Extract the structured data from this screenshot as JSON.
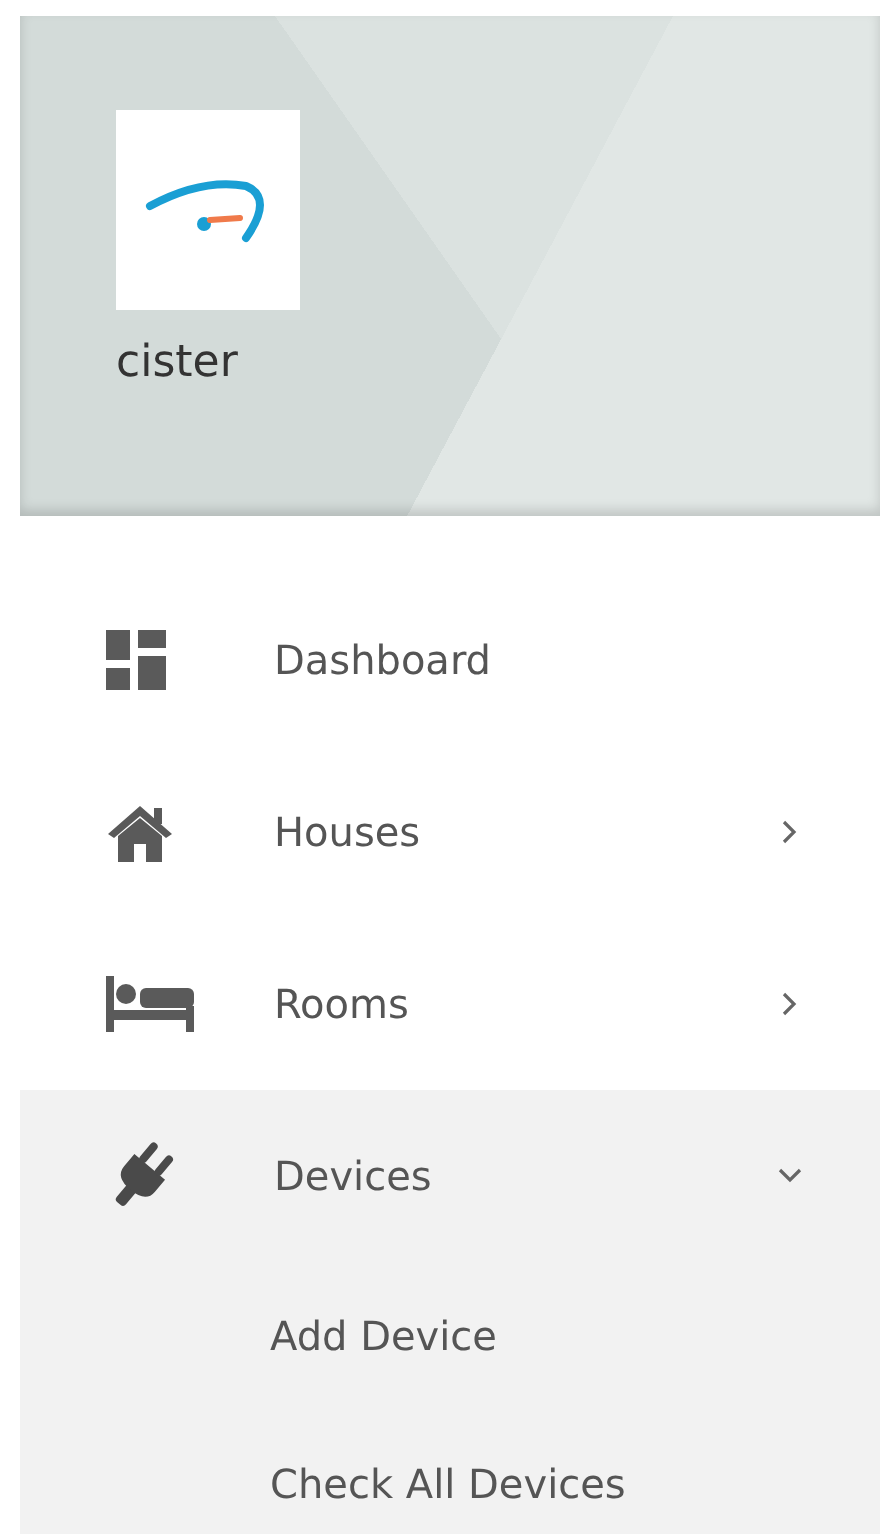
{
  "brand": {
    "name": "cister"
  },
  "menu": [
    {
      "kind": "link",
      "label": "Dashboard"
    },
    {
      "kind": "group",
      "label": "Houses",
      "expanded": false
    },
    {
      "kind": "group",
      "label": "Rooms",
      "expanded": false
    },
    {
      "kind": "group",
      "label": "Devices",
      "expanded": true,
      "children": [
        {
          "label": "Add Device"
        },
        {
          "label": "Check All Devices"
        }
      ]
    }
  ]
}
